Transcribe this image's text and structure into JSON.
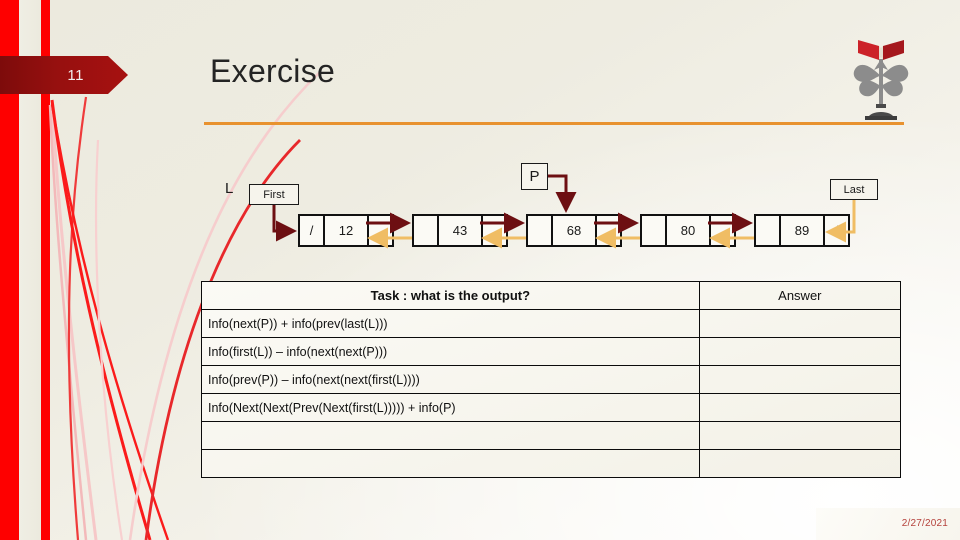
{
  "slide": {
    "number": "11",
    "title": "Exercise",
    "date": "2/27/2021",
    "accent_orange": "#e8922f",
    "accent_red": "#fe0000",
    "badge_red": "#97100f",
    "arrow_next_color": "#6d0f12",
    "arrow_prev_color": "#f0bd64"
  },
  "logo": {
    "name": "university-crest-logo",
    "book_color": "#cc2229",
    "crest_color": "#8c8c8c"
  },
  "diagram": {
    "list_label": "L",
    "first_label": "First",
    "last_label": "Last",
    "pointer_label": "P",
    "null_glyph": "/",
    "nodes": [
      {
        "prev": "/",
        "value": "12",
        "next": ""
      },
      {
        "prev": "",
        "value": "43",
        "next": ""
      },
      {
        "prev": "",
        "value": "68",
        "next": ""
      },
      {
        "prev": "",
        "value": "80",
        "next": ""
      },
      {
        "prev": "",
        "value": "89",
        "next": "/"
      }
    ],
    "pointer_target_index": 2
  },
  "table": {
    "headers": [
      "Task : what is the output?",
      "Answer"
    ],
    "rows": [
      {
        "task": "Info(next(P)) + info(prev(last(L)))",
        "answer": ""
      },
      {
        "task": "Info(first(L)) – info(next(next(P)))",
        "answer": ""
      },
      {
        "task": "Info(prev(P)) – info(next(next(first(L))))",
        "answer": ""
      },
      {
        "task": "Info(Next(Next(Prev(Next(first(L)))))  + info(P)",
        "answer": ""
      },
      {
        "task": "",
        "answer": ""
      },
      {
        "task": "",
        "answer": ""
      }
    ]
  }
}
